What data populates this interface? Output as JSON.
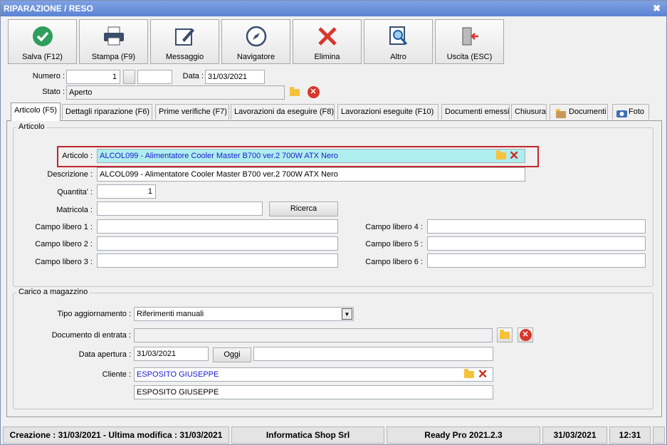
{
  "window": {
    "title": "RIPARAZIONE / RESO",
    "close_glyph": "✖"
  },
  "toolbar": {
    "salva": "Salva (F12)",
    "stampa": "Stampa (F9)",
    "messaggio": "Messaggio",
    "navigatore": "Navigatore",
    "elimina": "Elimina",
    "altro": "Altro",
    "uscita": "Uscita (ESC)"
  },
  "header": {
    "numero_label": "Numero :",
    "numero_value": "1",
    "data_label": "Data :",
    "data_value": "31/03/2021",
    "stato_label": "Stato :",
    "stato_value": "Aperto"
  },
  "tabs": [
    "Articolo (F5)",
    "Dettagli riparazione (F6)",
    "Prime verifiche (F7)",
    "Lavorazioni da eseguire (F8)",
    "Lavorazioni eseguite (F10)",
    "Documenti emessi",
    "Chiusura",
    "Documenti",
    "Foto"
  ],
  "articolo_group": {
    "title": "Articolo",
    "articolo_label": "Articolo :",
    "articolo_value": "ALCOL099 - Alimentatore Cooler Master B700 ver.2 700W ATX Nero",
    "descrizione_label": "Descrizione :",
    "descrizione_value": "ALCOL099 - Alimentatore Cooler Master B700 ver.2 700W ATX Nero",
    "quantita_label": "Quantita' :",
    "quantita_value": "1",
    "matricola_label": "Matricola :",
    "matricola_value": "",
    "ricerca": "Ricerca",
    "campo1_label": "Campo libero 1 :",
    "campo2_label": "Campo libero 2 :",
    "campo3_label": "Campo libero 3 :",
    "campo4_label": "Campo libero 4 :",
    "campo5_label": "Campo libero 5 :",
    "campo6_label": "Campo libero 6 :"
  },
  "carico_group": {
    "title": "Carico a magazzino",
    "tipo_label": "Tipo aggiornamento :",
    "tipo_value": "Riferimenti manuali",
    "documento_label": "Documento di entrata :",
    "documento_value": "",
    "data_apertura_label": "Data apertura :",
    "data_apertura_value": "31/03/2021",
    "oggi": "Oggi",
    "cliente_label": "Cliente :",
    "cliente_value": "ESPOSITO GIUSEPPE",
    "cliente_desc": "ESPOSITO GIUSEPPE"
  },
  "statusbar": {
    "creazione": "Creazione : 31/03/2021 - Ultima modifica : 31/03/2021",
    "company": "Informatica Shop Srl",
    "version": "Ready Pro 2021.2.3",
    "date": "31/03/2021",
    "time": "12:31"
  },
  "colors": {
    "title_bar": "#6b91d9",
    "highlight_border": "#c0262a",
    "articolo_bg": "#aeeeee",
    "link_text": "#1a1ad0"
  }
}
